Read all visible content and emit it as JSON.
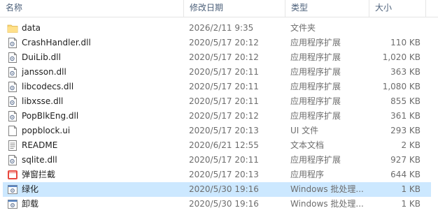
{
  "columns": {
    "name": "名称",
    "date": "修改日期",
    "type": "类型",
    "size": "大小"
  },
  "files": [
    {
      "name": "data",
      "date": "2026/2/11 9:35",
      "type": "文件夹",
      "size": "",
      "icon": "folder-icon"
    },
    {
      "name": "CrashHandler.dll",
      "date": "2020/5/17 20:12",
      "type": "应用程序扩展",
      "size": "110 KB",
      "icon": "dll-icon"
    },
    {
      "name": "DuiLib.dll",
      "date": "2020/5/17 20:12",
      "type": "应用程序扩展",
      "size": "1,020 KB",
      "icon": "dll-icon"
    },
    {
      "name": "jansson.dll",
      "date": "2020/5/17 20:11",
      "type": "应用程序扩展",
      "size": "363 KB",
      "icon": "dll-icon"
    },
    {
      "name": "libcodecs.dll",
      "date": "2020/5/17 20:11",
      "type": "应用程序扩展",
      "size": "1,080 KB",
      "icon": "dll-icon"
    },
    {
      "name": "libxsse.dll",
      "date": "2020/5/17 20:11",
      "type": "应用程序扩展",
      "size": "855 KB",
      "icon": "dll-icon"
    },
    {
      "name": "PopBlkEng.dll",
      "date": "2020/5/17 20:12",
      "type": "应用程序扩展",
      "size": "361 KB",
      "icon": "dll-icon"
    },
    {
      "name": "popblock.ui",
      "date": "2020/5/17 20:13",
      "type": "UI 文件",
      "size": "293 KB",
      "icon": "file-icon"
    },
    {
      "name": "README",
      "date": "2020/6/21 12:55",
      "type": "文本文档",
      "size": "2 KB",
      "icon": "text-file-icon"
    },
    {
      "name": "sqlite.dll",
      "date": "2020/5/17 20:11",
      "type": "应用程序扩展",
      "size": "927 KB",
      "icon": "dll-icon"
    },
    {
      "name": "弹窗拦截",
      "date": "2020/5/17 20:13",
      "type": "应用程序",
      "size": "644 KB",
      "icon": "app-icon"
    },
    {
      "name": "绿化",
      "date": "2020/5/30 19:16",
      "type": "Windows 批处理...",
      "size": "1 KB",
      "icon": "batch-file-icon",
      "selected": true
    },
    {
      "name": "卸载",
      "date": "2020/5/30 19:16",
      "type": "Windows 批处理...",
      "size": "1 KB",
      "icon": "batch-file-icon"
    }
  ],
  "colors": {
    "selected_row": "#cce8ff",
    "header_text": "#4c607a",
    "folder": "#f8d775"
  }
}
